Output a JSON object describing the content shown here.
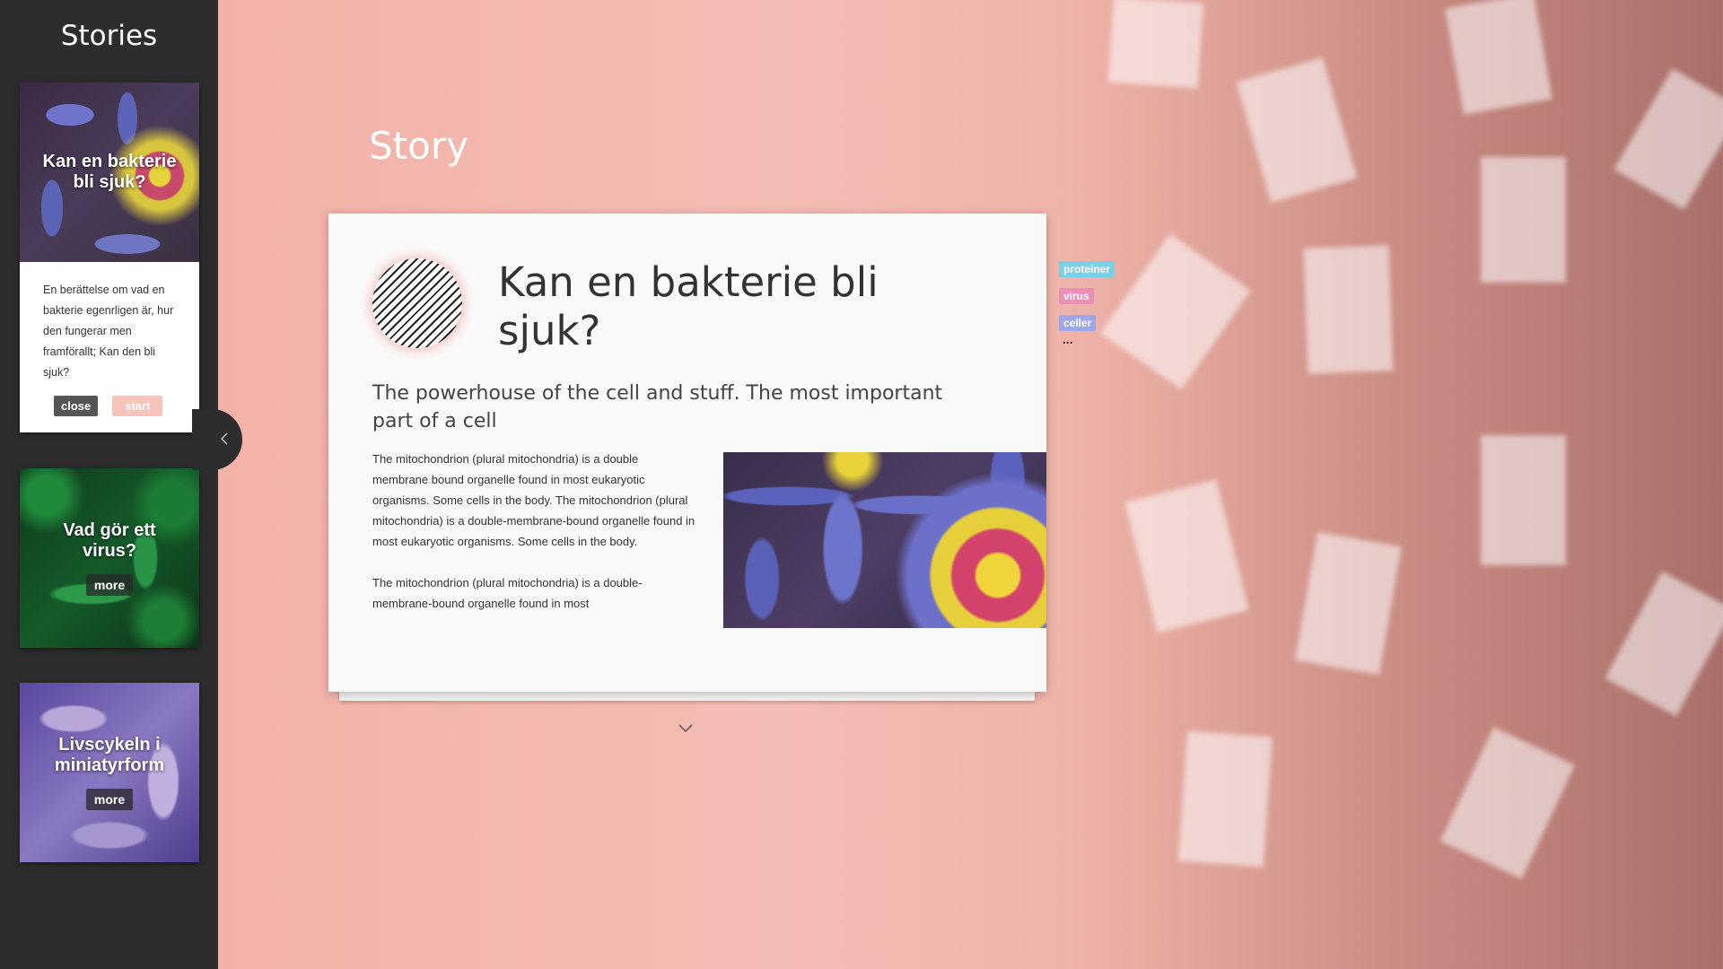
{
  "sidebar": {
    "title": "Stories",
    "cards": [
      {
        "title": "Kan en bakterie bli sjuk?",
        "description": "En berättelse om vad en bakterie egenrligen är, hur den fungerar men framförallt; Kan den bli sjuk?",
        "close_label": "close",
        "start_label": "start"
      },
      {
        "title": "Vad gör ett virus?",
        "more_label": "more"
      },
      {
        "title": "Livscykeln i miniatyrform",
        "more_label": "more"
      }
    ],
    "collapse_icon": "chevron-left-icon"
  },
  "main": {
    "heading": "Story",
    "story": {
      "title": "Kan en bakterie bli sjuk?",
      "subtitle": "The powerhouse of the cell and stuff. The most important part of a cell",
      "paragraphs": [
        "The mitochondrion (plural mitochondria) is a double membrane bound organelle found in most eukaryotic organisms. Some cells in the body. The mitochondrion (plural mitochondria) is a double-membrane-bound organelle found in most eukaryotic organisms. Some cells in the body.",
        "The mitochondrion (plural mitochondria) is a double-membrane-bound organelle found in most"
      ]
    },
    "down_icon": "chevron-down-icon"
  },
  "tags": {
    "items": [
      {
        "label": "proteiner",
        "color": "#7dcfe8"
      },
      {
        "label": "virus",
        "color": "#ec8fb8"
      },
      {
        "label": "celler",
        "color": "#9ea7e8"
      }
    ],
    "more": "..."
  },
  "colors": {
    "sidebar_bg": "#2d2d2d",
    "accent_pink": "#f2aea4",
    "start_button": "#f8c3bb",
    "close_button": "#555555"
  }
}
